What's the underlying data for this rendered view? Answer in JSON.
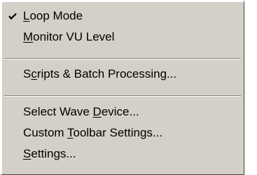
{
  "menu": {
    "items": [
      {
        "id": "loop-mode",
        "checked": true,
        "pre": "",
        "key": "L",
        "post": "oop Mode"
      },
      {
        "id": "monitor-vu-level",
        "checked": false,
        "pre": "",
        "key": "M",
        "post": "onitor VU Level"
      },
      {
        "id": "scripts-batch",
        "checked": false,
        "pre": "S",
        "key": "c",
        "post": "ripts & Batch Processing..."
      },
      {
        "id": "select-wave-device",
        "checked": false,
        "pre": "Select Wave ",
        "key": "D",
        "post": "evice..."
      },
      {
        "id": "custom-toolbar-settings",
        "checked": false,
        "pre": "Custom ",
        "key": "T",
        "post": "oolbar Settings..."
      },
      {
        "id": "settings",
        "checked": false,
        "pre": "",
        "key": "S",
        "post": "ettings..."
      }
    ],
    "check_icon": "checkmark-icon"
  }
}
